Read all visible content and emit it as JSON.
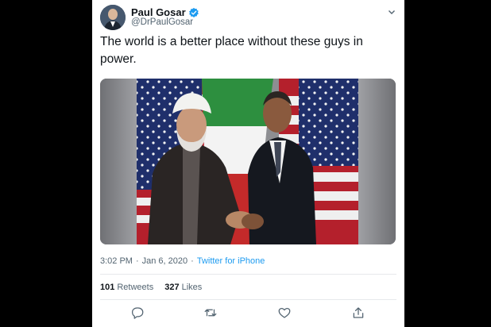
{
  "tweet": {
    "author_name": "Paul Gosar",
    "handle": "@DrPaulGosar",
    "text": "The world is a better place without these guys in power.",
    "time": "3:02 PM",
    "separator": "·",
    "date": "Jan 6, 2020",
    "source": "Twitter for iPhone"
  },
  "stats": {
    "retweets_count": "101",
    "retweets_label": "Retweets",
    "likes_count": "327",
    "likes_label": "Likes"
  },
  "icons": {
    "verified": "verified-badge-icon",
    "caret": "chevron-down-icon",
    "reply": "reply-icon",
    "retweet": "retweet-icon",
    "like": "heart-icon",
    "share": "share-icon"
  },
  "colors": {
    "accent": "#1d9bf0",
    "text": "#0f1419",
    "secondary": "#536471",
    "backdrop": "#000000"
  }
}
